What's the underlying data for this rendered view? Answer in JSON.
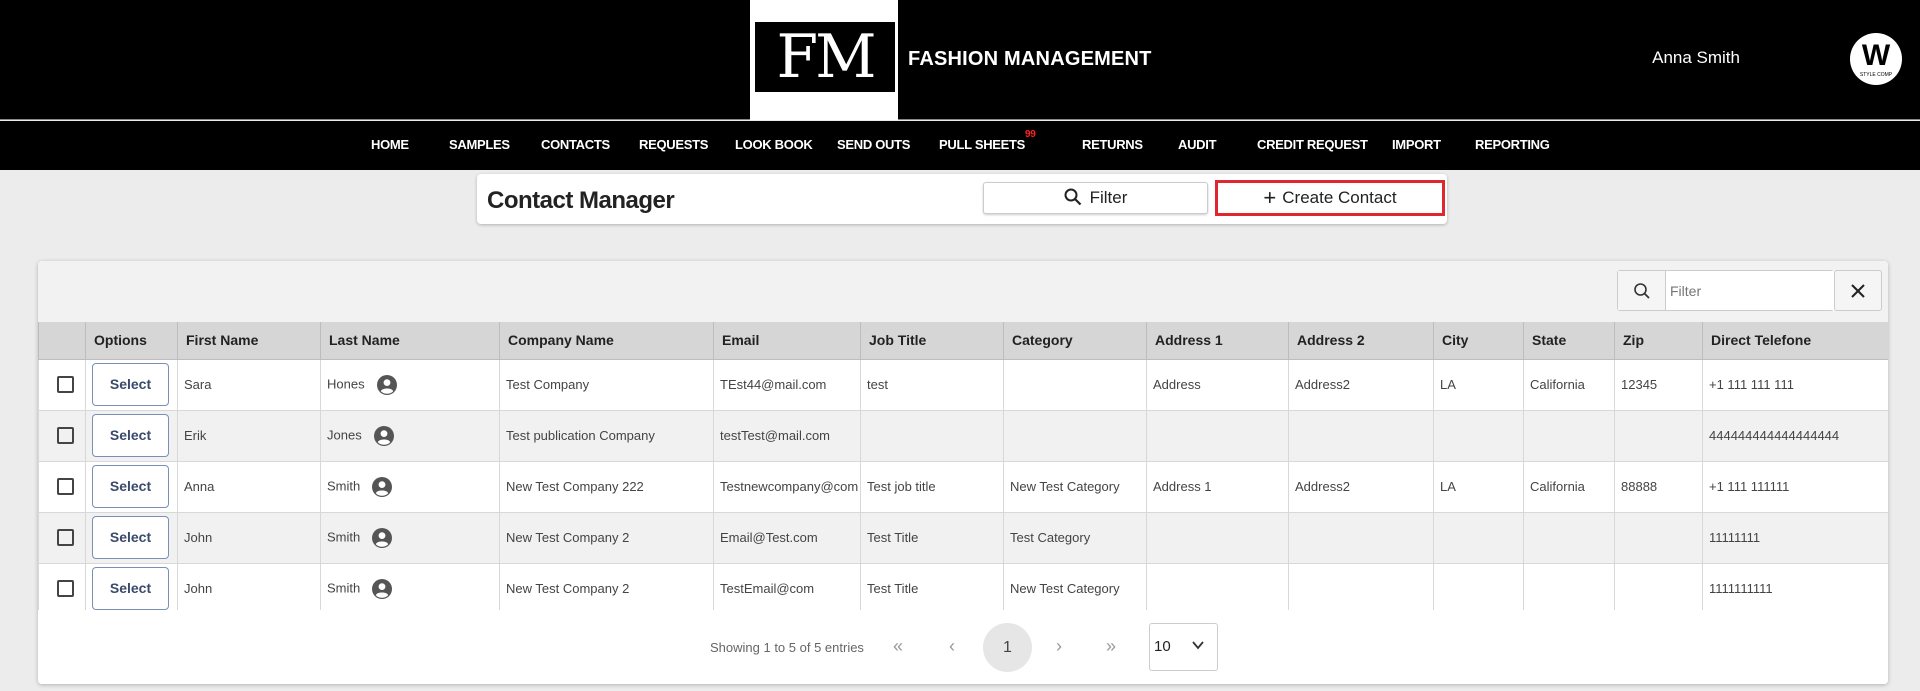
{
  "header": {
    "logo": "FM",
    "brand": "FASHION MANAGEMENT",
    "user_name": "Anna Smith",
    "avatar_letter": "W",
    "avatar_subtext": "STYLE COMP"
  },
  "nav": {
    "items": [
      {
        "label": "HOME"
      },
      {
        "label": "SAMPLES"
      },
      {
        "label": "CONTACTS"
      },
      {
        "label": "REQUESTS"
      },
      {
        "label": "LOOK BOOK"
      },
      {
        "label": "SEND OUTS"
      },
      {
        "label": "PULL SHEETS",
        "badge": "99"
      },
      {
        "label": "RETURNS"
      },
      {
        "label": "AUDIT"
      },
      {
        "label": "CREDIT REQUEST"
      },
      {
        "label": "IMPORT"
      },
      {
        "label": "REPORTING"
      }
    ]
  },
  "contact_manager": {
    "title": "Contact Manager",
    "filter_label": "Filter",
    "create_label": "Create Contact"
  },
  "table_filter": {
    "placeholder": "Filter"
  },
  "table": {
    "columns": [
      "Options",
      "First Name",
      "Last Name",
      "Company Name",
      "Email",
      "Job Title",
      "Category",
      "Address 1",
      "Address 2",
      "City",
      "State",
      "Zip",
      "Direct Telefone"
    ],
    "select_label": "Select",
    "rows": [
      {
        "first": "Sara",
        "last": "Hones",
        "company": "Test Company",
        "email": "TEst44@mail.com",
        "job": "test",
        "category": "",
        "addr1": "Address",
        "addr2": "Address2",
        "city": "LA",
        "state": "California",
        "zip": "12345",
        "phone": "+1 111 111 111"
      },
      {
        "first": "Erik",
        "last": "Jones",
        "company": "Test publication Company",
        "email": "testTest@mail.com",
        "job": "",
        "category": "",
        "addr1": "",
        "addr2": "",
        "city": "",
        "state": "",
        "zip": "",
        "phone": "444444444444444444"
      },
      {
        "first": "Anna",
        "last": "Smith",
        "company": "New Test Company 222",
        "email": "Testnewcompany@com",
        "job": "Test job title",
        "category": "New Test Category",
        "addr1": "Address 1",
        "addr2": "Address2",
        "city": "LA",
        "state": "California",
        "zip": "88888",
        "phone": "+1 111 111111"
      },
      {
        "first": "John",
        "last": "Smith",
        "company": "New Test Company 2",
        "email": "Email@Test.com",
        "job": "Test Title",
        "category": "Test Category",
        "addr1": "",
        "addr2": "",
        "city": "",
        "state": "",
        "zip": "",
        "phone": "11111111"
      },
      {
        "first": "John",
        "last": "Smith",
        "company": "New Test Company 2",
        "email": "TestEmail@com",
        "job": "Test Title",
        "category": "New Test Category",
        "addr1": "",
        "addr2": "",
        "city": "",
        "state": "",
        "zip": "",
        "phone": "1111111111"
      }
    ]
  },
  "pagination": {
    "info": "Showing 1 to 5 of 5 entries",
    "first": "«",
    "prev": "‹",
    "current": "1",
    "next": "›",
    "last": "»",
    "page_size": "10"
  },
  "colors": {
    "header_bg": "#000000",
    "highlight": "#e0262e",
    "badge": "#ff2020"
  }
}
